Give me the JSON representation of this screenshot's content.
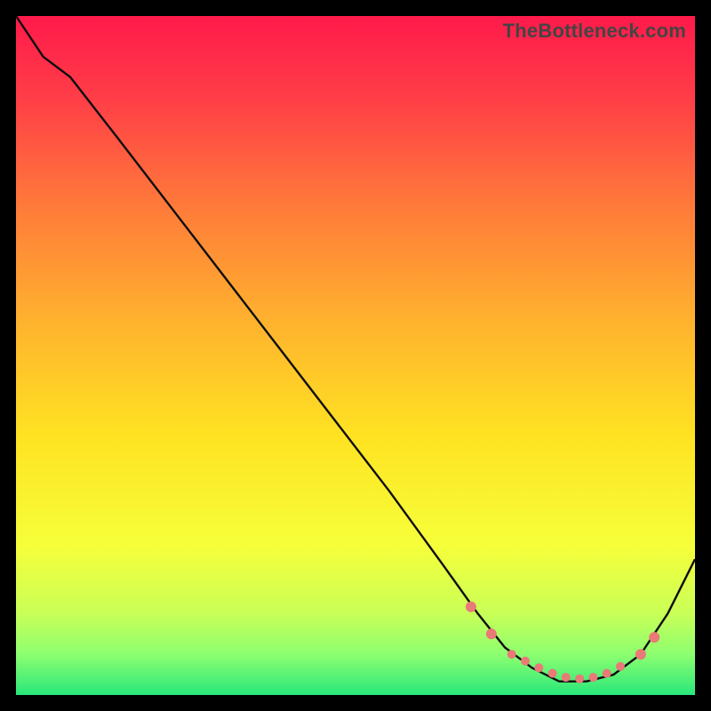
{
  "watermark": "TheBottleneck.com",
  "chart_data": {
    "type": "line",
    "title": "",
    "xlabel": "",
    "ylabel": "",
    "xlim": [
      0,
      100
    ],
    "ylim": [
      0,
      100
    ],
    "background": "rainbow-heat-gradient",
    "x": [
      0,
      4,
      8,
      15,
      25,
      35,
      45,
      55,
      63,
      68,
      72,
      76,
      80,
      84,
      88,
      92,
      96,
      100
    ],
    "values": [
      100,
      94,
      91,
      82,
      69,
      56,
      43,
      30,
      19,
      12,
      7,
      4,
      2,
      2,
      3,
      6,
      12,
      20
    ],
    "markers": {
      "x": [
        67,
        70,
        73,
        75,
        77,
        79,
        81,
        83,
        85,
        87,
        89,
        92,
        94
      ],
      "values": [
        13,
        9,
        6,
        5,
        4,
        3.2,
        2.6,
        2.4,
        2.6,
        3.2,
        4.2,
        6,
        8.5
      ],
      "color": "#e97a77",
      "sizes": [
        6,
        6,
        5,
        5,
        5,
        5,
        5,
        5,
        5,
        5,
        5,
        6,
        6
      ]
    }
  },
  "colors": {
    "curve": "#0e0e0e",
    "mark": "#e97a77"
  }
}
